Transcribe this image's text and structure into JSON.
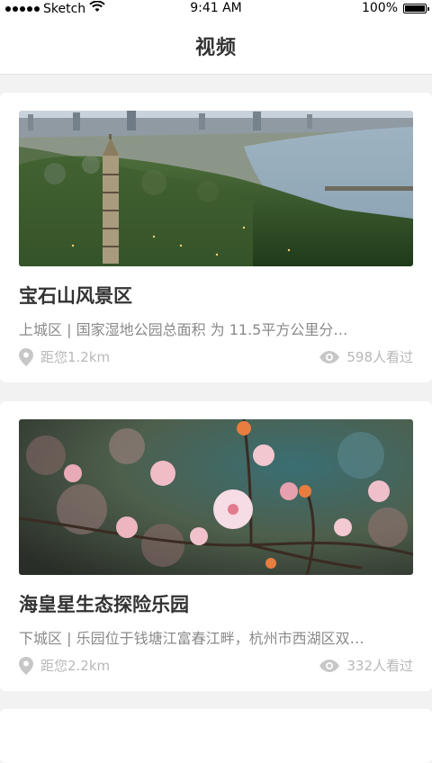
{
  "status_bar": {
    "carrier": "Sketch",
    "time": "9:41 AM",
    "battery": "100%"
  },
  "nav": {
    "title": "视频"
  },
  "cards": [
    {
      "title": "宝石山风景区",
      "description": "上城区 | 国家湿地公园总面积 为 11.5平方公里分…",
      "distance": "距您1.2km",
      "views": "598人看过",
      "image": "city-lake-photo"
    },
    {
      "title": "海皇星生态探险乐园",
      "description": "下城区 | 乐园位于钱塘江富春江畔，杭州市西湖区双…",
      "distance": "距您2.2km",
      "views": "332人看过",
      "image": "blossom-photo"
    }
  ],
  "icons": {
    "location": "location-pin-icon",
    "views": "eye-icon"
  },
  "colors": {
    "text_primary": "#333333",
    "text_secondary": "#8a8a8a",
    "text_meta": "#b8b8b8",
    "background": "#f2f2f2"
  }
}
